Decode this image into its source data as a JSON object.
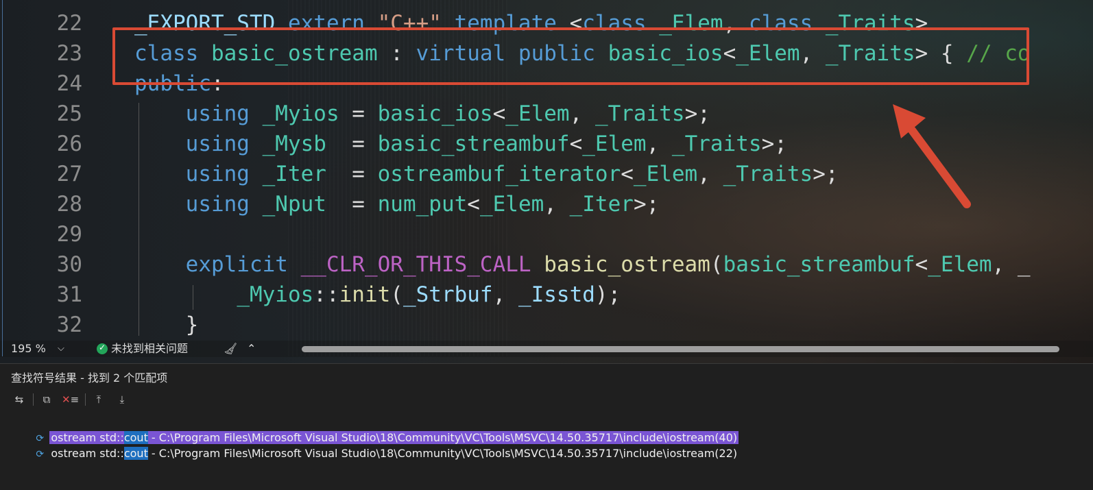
{
  "editor": {
    "lines": [
      {
        "n": "22",
        "parts": [
          [
            "pm",
            "_EXPORT_STD "
          ],
          [
            "kw",
            "extern "
          ],
          [
            "st",
            "\"C++\" "
          ],
          [
            "kw",
            "template "
          ],
          [
            "",
            "<"
          ],
          [
            "kw",
            "class "
          ],
          [
            "ty",
            "_Elem"
          ],
          [
            "",
            ", "
          ],
          [
            "kw",
            "class "
          ],
          [
            "ty",
            "_Traits"
          ],
          [
            "",
            ">"
          ]
        ]
      },
      {
        "n": "23",
        "parts": [
          [
            "kw",
            "class "
          ],
          [
            "ty",
            "basic_ostream "
          ],
          [
            "",
            ": "
          ],
          [
            "kw",
            "virtual public "
          ],
          [
            "ty",
            "basic_ios"
          ],
          [
            "",
            "<"
          ],
          [
            "ty",
            "_Elem"
          ],
          [
            "",
            ", "
          ],
          [
            "ty",
            "_Traits"
          ],
          [
            "",
            "> { "
          ],
          [
            "cm",
            "// co"
          ]
        ]
      },
      {
        "n": "24",
        "parts": [
          [
            "kw",
            "public"
          ],
          [
            "",
            ":"
          ]
        ]
      },
      {
        "n": "25",
        "parts": [
          [
            "",
            "    "
          ],
          [
            "kw",
            "using "
          ],
          [
            "ty",
            "_Myios "
          ],
          [
            "",
            "= "
          ],
          [
            "ty",
            "basic_ios"
          ],
          [
            "",
            "<"
          ],
          [
            "ty",
            "_Elem"
          ],
          [
            "",
            ", "
          ],
          [
            "ty",
            "_Traits"
          ],
          [
            "",
            ">;"
          ]
        ]
      },
      {
        "n": "26",
        "parts": [
          [
            "",
            "    "
          ],
          [
            "kw",
            "using "
          ],
          [
            "ty",
            "_Mysb  "
          ],
          [
            "",
            "= "
          ],
          [
            "ty",
            "basic_streambuf"
          ],
          [
            "",
            "<"
          ],
          [
            "ty",
            "_Elem"
          ],
          [
            "",
            ", "
          ],
          [
            "ty",
            "_Traits"
          ],
          [
            "",
            ">;"
          ]
        ]
      },
      {
        "n": "27",
        "parts": [
          [
            "",
            "    "
          ],
          [
            "kw",
            "using "
          ],
          [
            "ty",
            "_Iter  "
          ],
          [
            "",
            "= "
          ],
          [
            "ty",
            "ostreambuf_iterator"
          ],
          [
            "",
            "<"
          ],
          [
            "ty",
            "_Elem"
          ],
          [
            "",
            ", "
          ],
          [
            "ty",
            "_Traits"
          ],
          [
            "",
            ">;"
          ]
        ]
      },
      {
        "n": "28",
        "parts": [
          [
            "",
            "    "
          ],
          [
            "kw",
            "using "
          ],
          [
            "ty",
            "_Nput  "
          ],
          [
            "",
            "= "
          ],
          [
            "ty",
            "num_put"
          ],
          [
            "",
            "<"
          ],
          [
            "ty",
            "_Elem"
          ],
          [
            "",
            ", "
          ],
          [
            "ty",
            "_Iter"
          ],
          [
            "",
            ">;"
          ]
        ]
      },
      {
        "n": "29",
        "parts": []
      },
      {
        "n": "30",
        "parts": [
          [
            "",
            "    "
          ],
          [
            "kw",
            "explicit "
          ],
          [
            "mc",
            "__CLR_OR_THIS_CALL "
          ],
          [
            "fn",
            "basic_ostream"
          ],
          [
            "",
            "("
          ],
          [
            "ty",
            "basic_streambuf"
          ],
          [
            "",
            "<"
          ],
          [
            "ty",
            "_Elem"
          ],
          [
            "",
            ", _"
          ]
        ]
      },
      {
        "n": "31",
        "parts": [
          [
            "",
            "        "
          ],
          [
            "ty",
            "_Myios"
          ],
          [
            "",
            "::"
          ],
          [
            "fn",
            "init"
          ],
          [
            "",
            "("
          ],
          [
            "pm",
            "_Strbuf"
          ],
          [
            "",
            ", "
          ],
          [
            "pm",
            "_Isstd"
          ],
          [
            "",
            ");"
          ]
        ]
      },
      {
        "n": "32",
        "parts": [
          [
            "",
            "    }"
          ]
        ]
      }
    ]
  },
  "statusbar": {
    "zoom": "195 %",
    "issues": "未找到相关问题"
  },
  "panel": {
    "title": "查找符号结果 - 找到 2 个匹配项",
    "results": [
      {
        "prefix": "ostream std::",
        "match": "cout",
        "suffix": " - C:\\Program Files\\Microsoft Visual Studio\\18\\Community\\VC\\Tools\\MSVC\\14.50.35717\\include\\iostream(40)",
        "selected": true
      },
      {
        "prefix": "ostream std::",
        "match": "cout",
        "suffix": " - C:\\Program Files\\Microsoft Visual Studio\\18\\Community\\VC\\Tools\\MSVC\\14.50.35717\\include\\iostream(22)",
        "selected": false
      }
    ]
  },
  "colors": {
    "annotation": "#d94a34",
    "selection": "#7a55d4",
    "match_highlight": "#1e6fbf"
  }
}
